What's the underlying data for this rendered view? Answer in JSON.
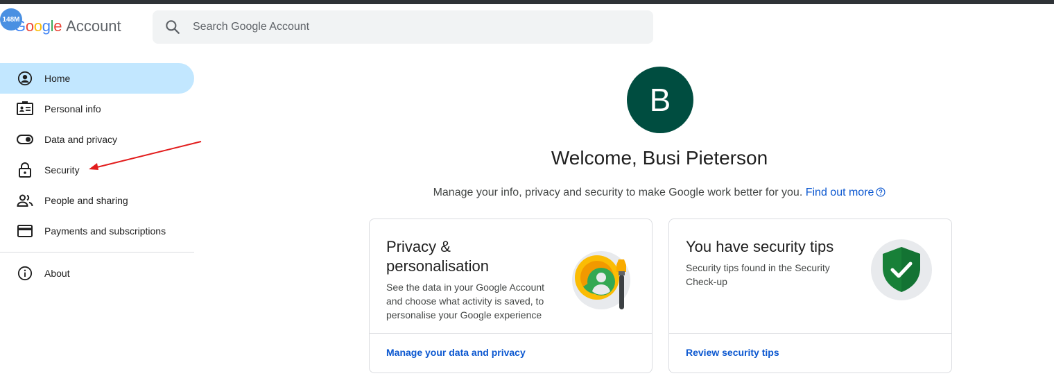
{
  "header": {
    "logo_letters": [
      "G",
      "o",
      "o",
      "g",
      "l",
      "e"
    ],
    "logo_colors": [
      "#4285f4",
      "#ea4335",
      "#fbbc05",
      "#4285f4",
      "#34a853",
      "#ea4335"
    ],
    "logo_suffix": "Account",
    "badge_text": "148M"
  },
  "search": {
    "placeholder": "Search Google Account",
    "icon": "search-icon"
  },
  "sidebar": {
    "items": [
      {
        "label": "Home",
        "icon": "account-circle-icon",
        "active": true
      },
      {
        "label": "Personal info",
        "icon": "id-card-icon"
      },
      {
        "label": "Data and privacy",
        "icon": "toggle-icon"
      },
      {
        "label": "Security",
        "icon": "lock-icon"
      },
      {
        "label": "People and sharing",
        "icon": "people-icon"
      },
      {
        "label": "Payments and subscriptions",
        "icon": "credit-card-icon"
      },
      {
        "label": "About",
        "icon": "info-icon"
      }
    ]
  },
  "main": {
    "avatar_letter": "B",
    "avatar_color": "#004d40",
    "welcome": "Welcome, Busi Pieterson",
    "subtitle": "Manage your info, privacy and security to make Google work better for you.",
    "subtitle_link": "Find out more",
    "cards": [
      {
        "title_line1": "Privacy &",
        "title_line2": "personalisation",
        "desc_line1": "See the data in your Google Account",
        "desc_line2": "and choose what activity is saved, to",
        "desc_line3": "personalise your Google experience",
        "link": "Manage your data and privacy",
        "illustration": "privacy-illustration-icon"
      },
      {
        "title": "You have security tips",
        "desc_line1": "Security tips found in the Security",
        "desc_line2": "Check-up",
        "link": "Review security tips",
        "illustration": "shield-check-icon"
      }
    ]
  },
  "colors": {
    "accent": "#0b57d0",
    "active_nav": "#c2e7ff",
    "annotation_arrow": "#e21c1c"
  }
}
